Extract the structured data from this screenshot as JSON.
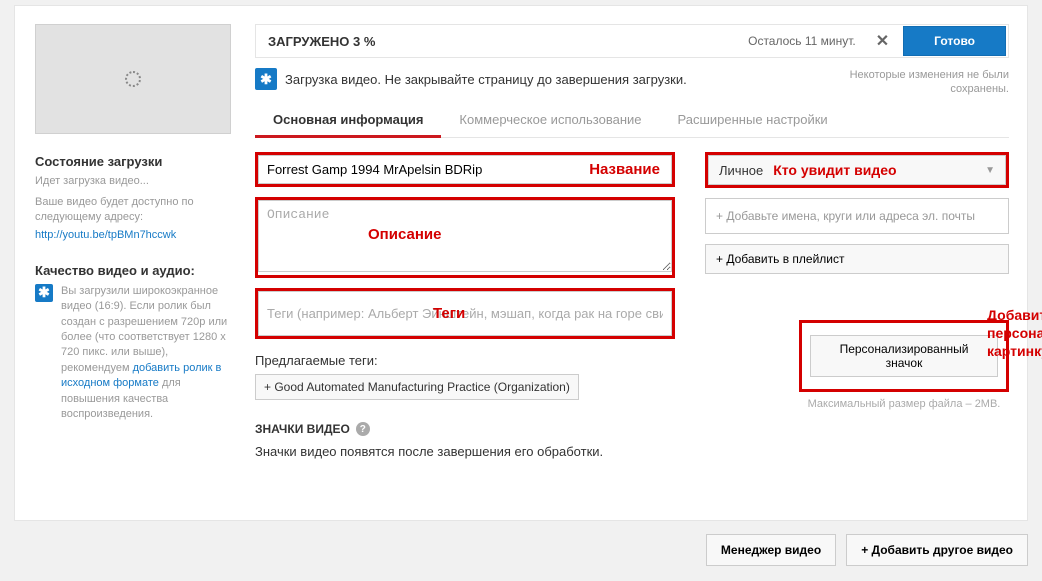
{
  "upload": {
    "status_header": "ЗАГРУЖЕНО 3 %",
    "remaining": "Осталось 11 минут.",
    "done_btn": "Готово",
    "uploading_msg": "Загрузка видео. Не закрывайте страницу до завершения загрузки.",
    "save_info_line1": "Некоторые изменения не были",
    "save_info_line2": "сохранены."
  },
  "sidebar": {
    "status_title": "Состояние загрузки",
    "status_text": "Идет загрузка видео...",
    "url_intro": "Ваше видео будет доступно по следующему адресу:",
    "url": "http://youtu.be/tpBMn7hccwk",
    "quality_title": "Качество видео и аудио:",
    "quality_text_1": "Вы загрузили широкоэкранное видео (16:9). Если ролик был создан с разрешением 720p или более (что соответствует 1280 x 720 пикс. или выше), рекомендуем ",
    "quality_link": "добавить ролик в исходном формате",
    "quality_text_2": " для повышения качества воспроизведения."
  },
  "tabs": {
    "basic": "Основная информация",
    "commercial": "Коммерческое использование",
    "advanced": "Расширенные настройки"
  },
  "form": {
    "title_value": "Forrest Gamp 1994 MrApelsin BDRip",
    "title_label": "Название",
    "desc_placeholder": "Описание",
    "desc_label": "Описание",
    "tags_placeholder": "Теги (например: Альберт Эйнштейн, мэшап, когда рак на горе сви",
    "tags_label": "Теги",
    "privacy_value": "Личное",
    "privacy_label": "Кто увидит видео",
    "share_placeholder": "+ Добавьте имена, круги или адреса эл. почты",
    "playlist_btn": "+ Добавить в плейлист",
    "suggested_label": "Предлагаемые теги:",
    "suggested_tag": "+ Good Automated Manufacturing Practice (Organization)"
  },
  "thumbs": {
    "heading": "ЗНАЧКИ ВИДЕО",
    "sub": "Значки видео появятся после завершения его обработки.",
    "custom_btn": "Персонализированный значок",
    "max_size": "Максимальный размер файла – 2MB.",
    "add_label": "Добавить персональную картинку"
  },
  "bottom": {
    "manager": "Менеджер видео",
    "add_another": "+  Добавить другое видео"
  }
}
